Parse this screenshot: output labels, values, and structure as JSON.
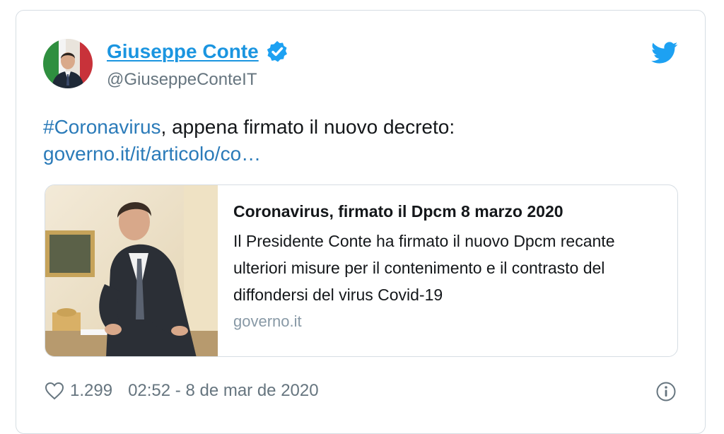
{
  "author": {
    "name": "Giuseppe Conte",
    "handle": "@GiuseppeConteIT",
    "verified": true
  },
  "tweet": {
    "hashtag": "#Coronavirus",
    "text": ", appena firmato il nuovo decreto:",
    "link": "governo.it/it/articolo/co…"
  },
  "card": {
    "title": "Coronavirus, firmato il Dpcm 8 marzo 2020",
    "description": "Il Presidente Conte ha firmato il nuovo Dpcm recante ulteriori misure per il contenimento e il contrasto del diffondersi del virus Covid-19",
    "domain": "governo.it"
  },
  "footer": {
    "likes": "1.299",
    "timestamp": "02:52 - 8 de mar de 2020"
  },
  "icons": {
    "verified": "verified-badge-icon",
    "brand": "twitter-bird-icon",
    "like": "heart-icon",
    "info": "info-icon"
  },
  "colors": {
    "link": "#2b7bb9",
    "name": "#1b95e0",
    "twitter": "#1da1f2",
    "muted": "#66757f",
    "border": "#d6dde3"
  }
}
